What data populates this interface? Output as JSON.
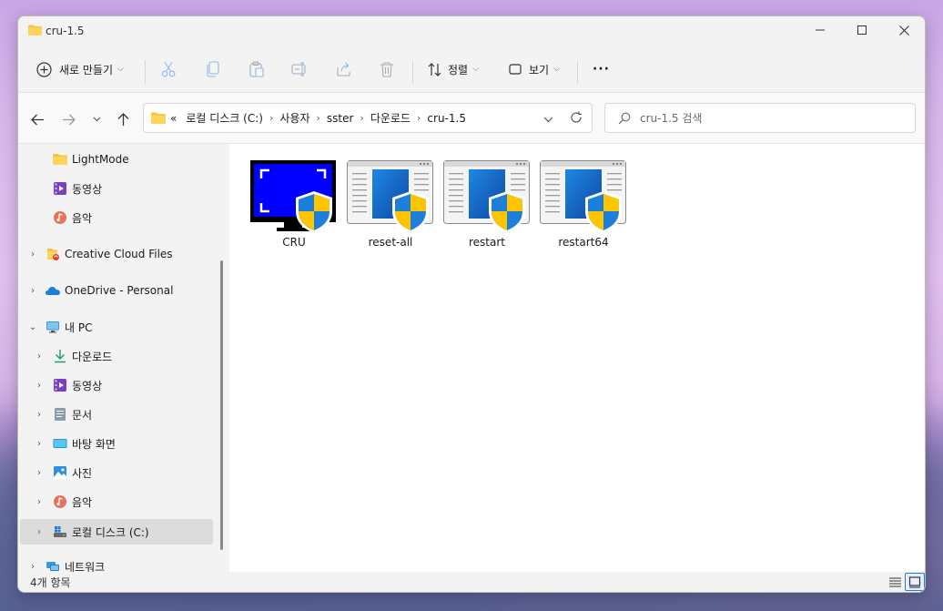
{
  "window": {
    "title": "cru-1.5"
  },
  "toolbar": {
    "new_label": "새로 만들기",
    "sort_label": "정렬",
    "view_label": "보기",
    "more_label": "···"
  },
  "address": {
    "overflow": "«",
    "crumbs": [
      "로컬 디스크 (C:)",
      "사용자",
      "sster",
      "다운로드",
      "cru-1.5"
    ]
  },
  "search": {
    "placeholder": "cru-1.5 검색"
  },
  "sidebar": {
    "items": [
      {
        "label": "LightMode",
        "icon": "folder-icon"
      },
      {
        "label": "동영상",
        "icon": "videos-icon"
      },
      {
        "label": "음악",
        "icon": "music-icon"
      },
      {
        "label": "Creative Cloud Files",
        "icon": "creative-cloud-folder-icon"
      },
      {
        "label": "OneDrive - Personal",
        "icon": "onedrive-cloud-icon"
      },
      {
        "label": "내 PC",
        "icon": "pc-icon"
      },
      {
        "label": "다운로드",
        "icon": "download-icon"
      },
      {
        "label": "동영상",
        "icon": "videos-icon"
      },
      {
        "label": "문서",
        "icon": "documents-icon"
      },
      {
        "label": "바탕 화면",
        "icon": "desktop-icon"
      },
      {
        "label": "사진",
        "icon": "pictures-icon"
      },
      {
        "label": "음악",
        "icon": "music-icon"
      },
      {
        "label": "로컬 디스크 (C:)",
        "icon": "drive-icon"
      },
      {
        "label": "네트워크",
        "icon": "network-icon"
      }
    ]
  },
  "files": [
    {
      "name": "CRU",
      "icon": "monitor-shield-icon"
    },
    {
      "name": "reset-all",
      "icon": "window-shield-icon"
    },
    {
      "name": "restart",
      "icon": "window-shield-icon"
    },
    {
      "name": "restart64",
      "icon": "window-shield-icon"
    }
  ],
  "status": {
    "item_count": "4개 항목"
  },
  "colors": {
    "accent": "#2b78d4",
    "folder": "#f5c542",
    "selected_bg": "#dcdcdc",
    "cru_blue": "#0000ff"
  }
}
